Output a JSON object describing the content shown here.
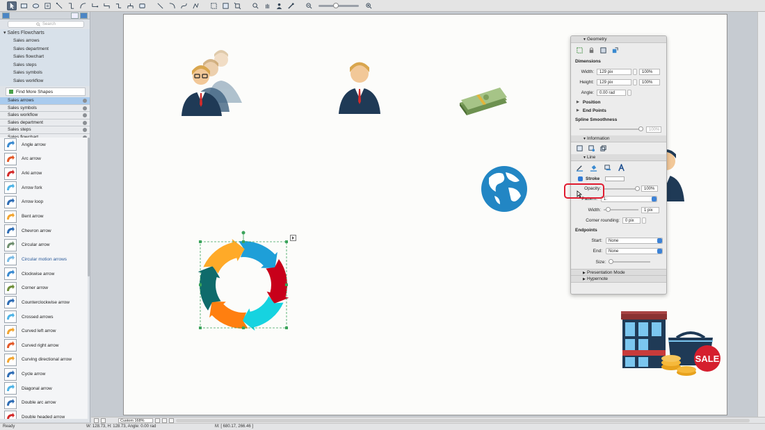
{
  "toolbar": {
    "tools": [
      "select-icon",
      "rectangle-icon",
      "ellipse-icon",
      "text-icon",
      "connector-icon",
      "smart-connector-icon",
      "arc-connector-icon",
      "bezier-connector-icon",
      "rounded-connector-icon",
      "chain-connector-icon",
      "tree-connector-icon",
      "container-icon",
      "line-icon",
      "arc-icon",
      "bezier-icon",
      "polyline-icon",
      "zoom-fit-icon",
      "zoom-page-icon",
      "zoom-selection-icon",
      "search-zoom-icon",
      "pan-icon",
      "person-icon",
      "eyedropper-icon",
      "zoom-out-icon",
      "zoom-in-icon"
    ],
    "zoom_fraction": 0.42
  },
  "library": {
    "search_placeholder": "Search",
    "tree_title": "Sales Flowcharts",
    "tree_items": [
      "Sales arrows",
      "Sales department",
      "Sales flowchart",
      "Sales steps",
      "Sales symbols",
      "Sales workflow"
    ],
    "find_more": "Find More Shapes",
    "open_libraries": [
      {
        "label": "Sales arrows",
        "selected": true
      },
      {
        "label": "Sales symbols",
        "selected": false
      },
      {
        "label": "Sales workflow",
        "selected": false
      },
      {
        "label": "Sales department",
        "selected": false
      },
      {
        "label": "Sales steps",
        "selected": false
      },
      {
        "label": "Sales flowchart",
        "selected": false
      }
    ],
    "shapes": [
      "Angle arrow",
      "Arc arrow",
      "Arki arrow",
      "Arrow fork",
      "Arrow loop",
      "Bent arrow",
      "Chevron arrow",
      "Circular arrow",
      "Circular motion arrows",
      "Clockwise arrow",
      "Corner arrow",
      "Counterclockwise arrow",
      "Crossed arrows",
      "Curved left arrow",
      "Curved right arrow",
      "Curving directional arrow",
      "Cycle arrow",
      "Diagonal arrow",
      "Double arc arrow",
      "Double headed arrow"
    ],
    "selected_shape": "Circular motion arrows"
  },
  "props": {
    "geometry": "Geometry",
    "dimensions": "Dimensions",
    "width_label": "Width:",
    "width_value": "129 pix",
    "width_pct": "100%",
    "height_label": "Height:",
    "height_value": "129 pix",
    "height_pct": "100%",
    "angle_label": "Angle:",
    "angle_value": "0.00 rad",
    "position": "Position",
    "end_points": "End Points",
    "spline": "Spline Smoothness",
    "spline_value": "100%",
    "information": "Information",
    "line": "Line",
    "stroke": "Stroke",
    "opacity_label": "Opacity:",
    "opacity_value": "100%",
    "pattern_label": "Pattern:",
    "pattern_value": "1:",
    "linewidth_label": "Width:",
    "linewidth_value": "1 pix",
    "corner_label": "Corner rounding:",
    "corner_value": "0 pix",
    "endpoints": "Endpoints",
    "start_label": "Start:",
    "start_value": "None",
    "end_label": "End:",
    "end_value": "None",
    "size_label": "Size:",
    "presentation": "Presentation Mode",
    "hypernote": "Hypernote"
  },
  "canvas": {
    "sale_text": "SALE"
  },
  "bottom": {
    "zoom": "Custom 168%"
  },
  "status": {
    "ready": "Ready",
    "dims": "W: 128.73,  H: 128.73,  Angle: 0.00 rad",
    "mouse": "M: [ 680.17, 266.46 ]"
  },
  "colors": {
    "accent": "#4b86c5",
    "highlight": "#e01b2f",
    "cycle": [
      "#1e9fd8",
      "#c8001a",
      "#16d3e0",
      "#ff7f10",
      "#0f6b6b",
      "#ffaa28"
    ]
  }
}
